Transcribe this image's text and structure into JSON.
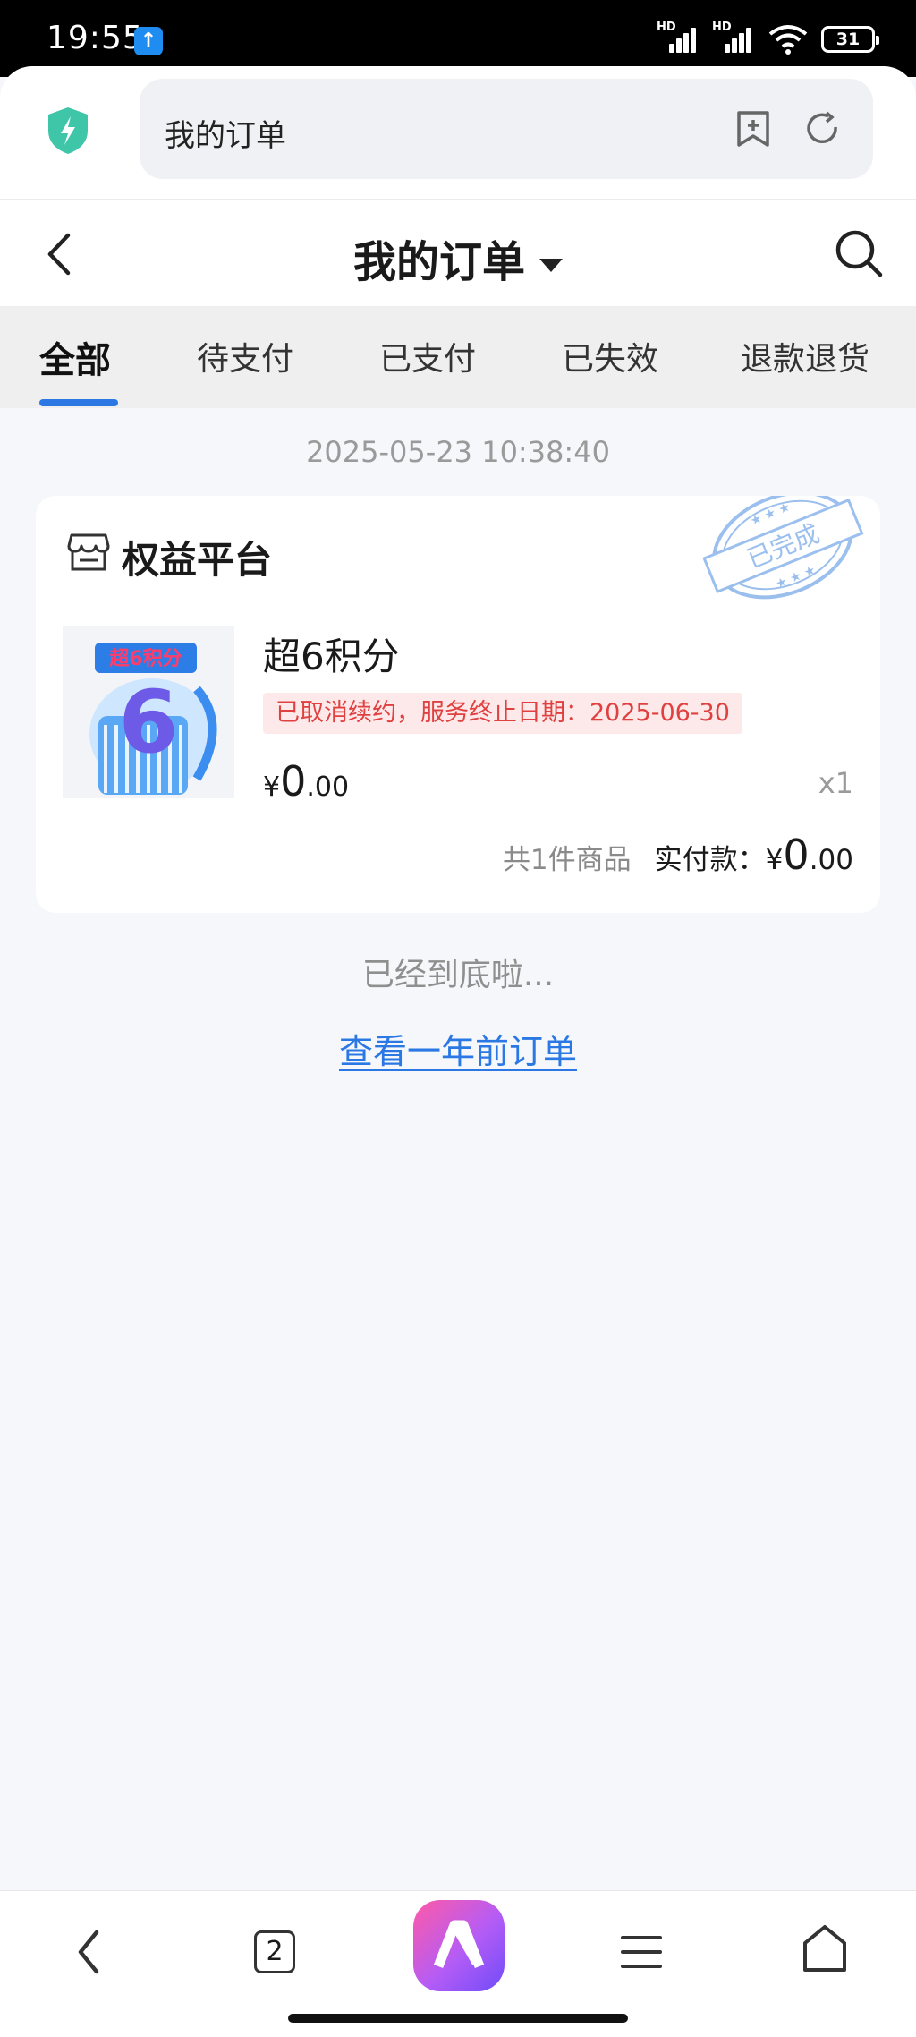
{
  "status_bar": {
    "time": "19:55",
    "signal_1_label": "HD",
    "signal_2_label": "HD",
    "battery": "31",
    "app_badge_icon": "upload-icon"
  },
  "browser": {
    "url_text": "我的订单",
    "security_icon": "shield-bolt-icon",
    "bookmark_icon": "bookmark-add-icon",
    "reload_icon": "reload-icon"
  },
  "header": {
    "title": "我的订单",
    "back_icon": "chevron-left-icon",
    "search_icon": "search-icon"
  },
  "tabs": [
    {
      "label": "全部",
      "active": true
    },
    {
      "label": "待支付",
      "active": false
    },
    {
      "label": "已支付",
      "active": false
    },
    {
      "label": "已失效",
      "active": false
    },
    {
      "label": "退款退货",
      "active": false
    }
  ],
  "order": {
    "time": "2025-05-23 10:38:40",
    "store": "权益平台",
    "stamp": "已完成",
    "product": {
      "thumb_text": "超6积分",
      "thumb_digit": "6",
      "name": "超6积分",
      "notice": "已取消续约，服务终止日期：2025-06-30",
      "currency": "¥",
      "price_int": "0",
      "price_dec": ".00",
      "qty": "x1"
    },
    "summary": {
      "count": "共1件商品",
      "paid_label": "实付款：",
      "currency": "¥",
      "paid_int": "0",
      "paid_dec": ".00"
    }
  },
  "footer": {
    "end_text": "已经到底啦...",
    "old_orders_link": "查看一年前订单"
  },
  "bottom_bar": {
    "tabs_count": "2",
    "ai_label": "AI"
  },
  "colors": {
    "accent": "#2b78e4",
    "notice_bg": "#fde9e9",
    "notice_text": "#e04040",
    "page_bg": "#f5f7fb"
  }
}
